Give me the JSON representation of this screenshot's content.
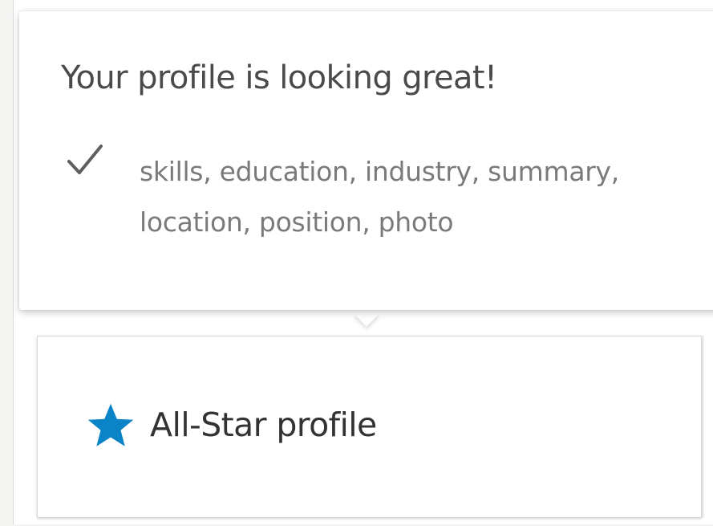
{
  "popover": {
    "title": "Your profile is looking great!",
    "completed_items": "skills, education, industry, summary, location, position, photo",
    "check_icon": "checkmark-icon"
  },
  "strength": {
    "label": "All-Star profile",
    "star_icon": "star-icon",
    "star_color": "#0a84c6"
  }
}
